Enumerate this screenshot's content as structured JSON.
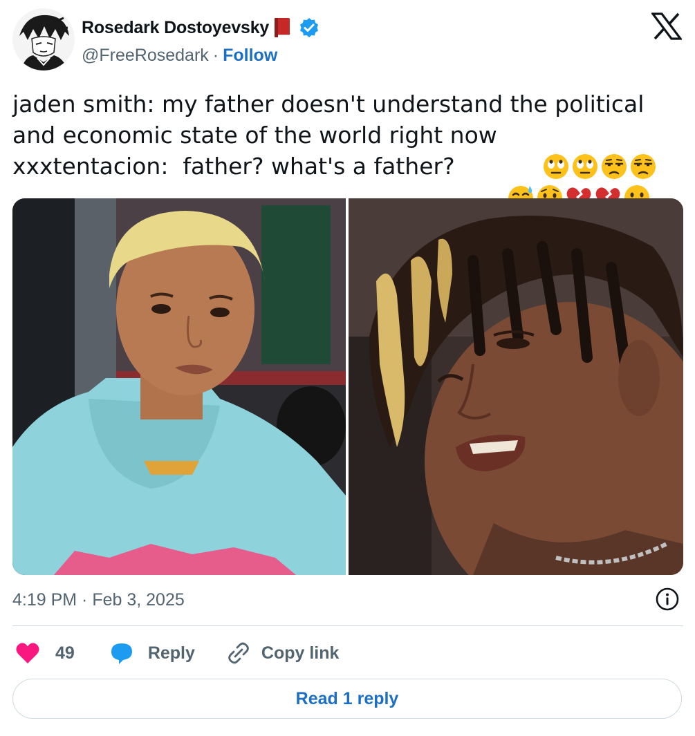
{
  "author": {
    "display_name": "Rosedark Dostoyevsky",
    "name_emoji": "closed-book-emoji",
    "verified": true,
    "handle": "@FreeRosedark",
    "separator": "·",
    "follow_label": "Follow"
  },
  "platform_logo": "x-logo",
  "tweet": {
    "lines": [
      {
        "text": "jaden smith: my father doesn't understand the political",
        "emojis": []
      },
      {
        "text": "and economic state of the world right now",
        "emojis": [
          "face-with-rolling-eyes",
          "face-with-rolling-eyes",
          "unamused-face",
          "unamused-face"
        ]
      },
      {
        "text": "xxxtentacion:  father? what's a father? ",
        "emojis": [
          "grinning-face-with-sweat",
          "crying-face",
          "broken-heart",
          "broken-heart",
          "confused-face"
        ]
      }
    ]
  },
  "media": [
    {
      "description_icon": "photo-jaden-smith"
    },
    {
      "description_icon": "photo-xxxtentacion"
    }
  ],
  "timestamp": "4:19 PM · Feb 3, 2025",
  "actions": {
    "like_count": "49",
    "reply_label": "Reply",
    "copy_link_label": "Copy link"
  },
  "read_replies_label": "Read 1 reply",
  "colors": {
    "link_blue": "#1d6fc4",
    "verified_blue": "#1d9bf0",
    "like_pink": "#f91880",
    "reply_blue": "#1d9bf0",
    "muted_text": "#536471",
    "divider": "#cfd9de"
  }
}
